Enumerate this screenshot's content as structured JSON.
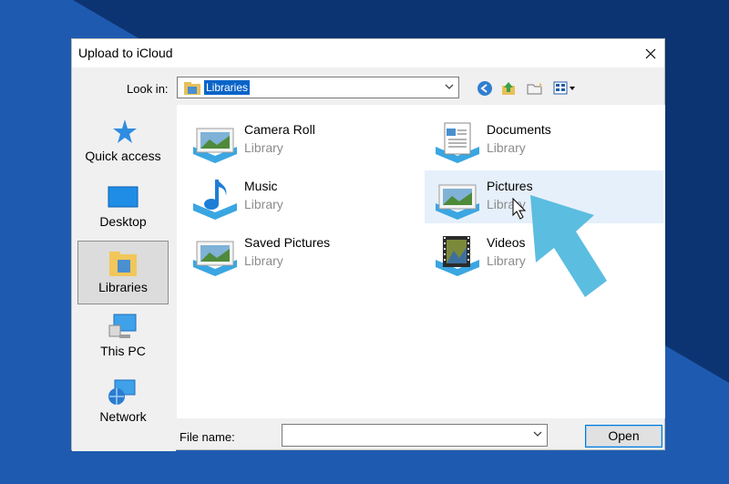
{
  "dialog": {
    "title": "Upload to iCloud",
    "close_icon": "close-icon"
  },
  "toolbar": {
    "look_in_label": "Look in:",
    "look_in_value": "Libraries",
    "icons": [
      "back-icon",
      "up-folder-icon",
      "new-folder-icon",
      "view-menu-icon"
    ]
  },
  "places": [
    {
      "label": "Quick access",
      "icon": "star-icon"
    },
    {
      "label": "Desktop",
      "icon": "desktop-icon"
    },
    {
      "label": "Libraries",
      "icon": "libraries-icon",
      "selected": true
    },
    {
      "label": "This PC",
      "icon": "computer-icon"
    },
    {
      "label": "Network",
      "icon": "network-icon"
    }
  ],
  "files": [
    {
      "name": "Camera Roll",
      "type": "Library",
      "icon": "picture-library-icon"
    },
    {
      "name": "Documents",
      "type": "Library",
      "icon": "document-library-icon"
    },
    {
      "name": "Music",
      "type": "Library",
      "icon": "music-library-icon"
    },
    {
      "name": "Pictures",
      "type": "Library",
      "icon": "picture-library-icon",
      "hovered": true
    },
    {
      "name": "Saved Pictures",
      "type": "Library",
      "icon": "picture-library-icon"
    },
    {
      "name": "Videos",
      "type": "Library",
      "icon": "video-library-icon"
    }
  ],
  "footer": {
    "file_name_label": "File name:",
    "file_name_value": "",
    "open_label": "Open"
  },
  "colors": {
    "background": "#0d3472",
    "background_light": "#1e5bb0",
    "selection": "#0a64c8",
    "hover": "#e5f0fb",
    "annotation_arrow": "#5bbde0"
  }
}
